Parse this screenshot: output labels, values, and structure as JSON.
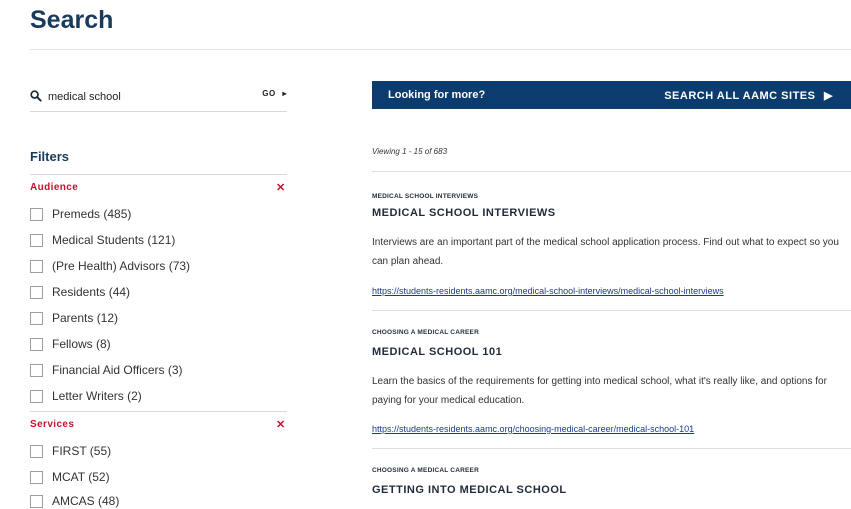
{
  "page": {
    "title": "Search"
  },
  "search": {
    "value": "medical school",
    "placeholder": "",
    "go_label": "GO"
  },
  "filters": {
    "title": "Filters",
    "groups": [
      {
        "name": "Audience",
        "options": [
          "Premeds (485)",
          "Medical Students (121)",
          "(Pre Health) Advisors (73)",
          "Residents (44)",
          "Parents (12)",
          "Fellows (8)",
          "Financial Aid Officers (3)",
          "Letter Writers (2)"
        ]
      },
      {
        "name": "Services",
        "options": [
          "FIRST (55)",
          "MCAT (52)",
          "AMCAS (48)"
        ]
      }
    ]
  },
  "banner": {
    "left": "Looking for more?",
    "right": "SEARCH ALL AAMC SITES"
  },
  "results": {
    "viewing": "Viewing 1 - 15 of 683",
    "items": [
      {
        "category": "MEDICAL SCHOOL INTERVIEWS",
        "title": "MEDICAL SCHOOL INTERVIEWS",
        "desc": "Interviews are an important part of the medical school application process. Find out what to expect so you can plan ahead.",
        "url": "https://students-residents.aamc.org/medical-school-interviews/medical-school-interviews"
      },
      {
        "category": "CHOOSING A MEDICAL CAREER",
        "title": "MEDICAL SCHOOL 101",
        "desc": "Learn the basics of the requirements for getting into medical school, what it's really like, and options for paying for your medical education.",
        "url": "https://students-residents.aamc.org/choosing-medical-career/medical-school-101"
      },
      {
        "category": "CHOOSING A MEDICAL CAREER",
        "title": "GETTING INTO MEDICAL SCHOOL",
        "desc": "",
        "url": ""
      }
    ]
  },
  "icons": {
    "search": "search-icon",
    "go_arrow": "caret-right-icon",
    "close": "close-icon",
    "banner_arrow": "caret-right-icon"
  },
  "colors": {
    "brand_navy": "#1a3a5c",
    "banner_bg": "#0c3b6e",
    "accent_red": "#c8102e",
    "link": "#1a3a8c"
  }
}
